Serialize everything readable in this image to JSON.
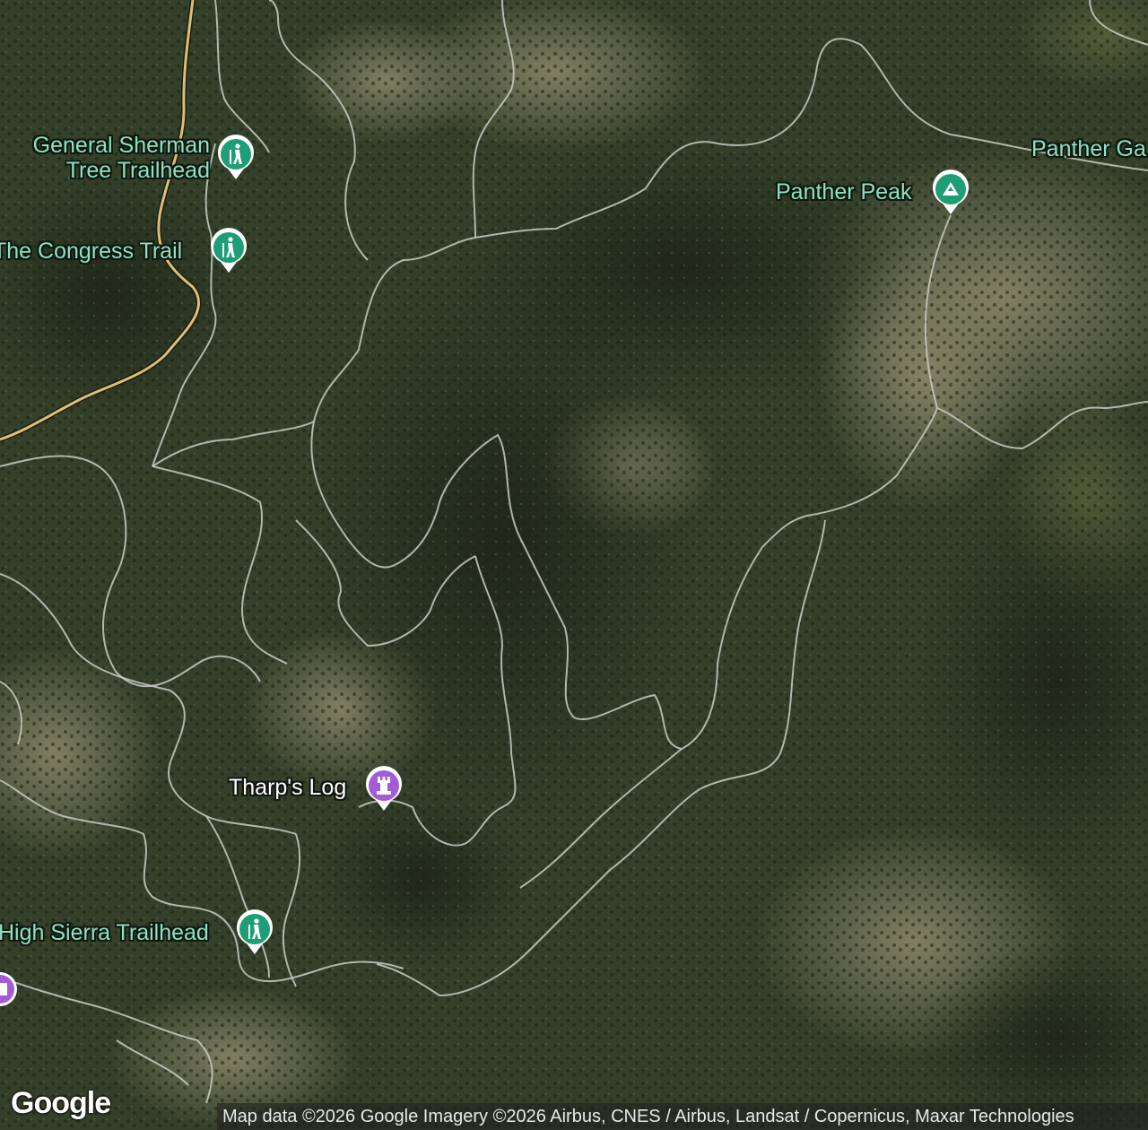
{
  "map": {
    "type": "satellite",
    "colors": {
      "terrain_dark": "#26301d",
      "terrain_mid": "#3b4529",
      "terrain_light": "#8d8a6e",
      "trail": "#c9cbc4",
      "road": "#d9bf7a",
      "hiking_pin": "#1e9e74",
      "landmark_pin": "#a35bd6",
      "peak_pin": "#1e9e74"
    }
  },
  "places": {
    "general_sherman": {
      "line1": "General Sherman",
      "line2": "Tree Trailhead",
      "icon": "hiking-icon"
    },
    "congress_trail": {
      "label": "The Congress Trail",
      "icon": "hiking-icon"
    },
    "panther_peak": {
      "label": "Panther Peak",
      "icon": "mountain-icon"
    },
    "panther_gap": {
      "label": "Panther Ga"
    },
    "tharps_log": {
      "label": "Tharp's Log",
      "icon": "landmark-icon"
    },
    "high_sierra": {
      "label": "High Sierra Trailhead",
      "icon": "hiking-icon"
    },
    "edge_landmark": {
      "icon": "landmark-icon"
    }
  },
  "logo": "Google",
  "attribution": "Map data ©2026 Google Imagery ©2026 Airbus, CNES / Airbus, Landsat / Copernicus, Maxar Technologies"
}
